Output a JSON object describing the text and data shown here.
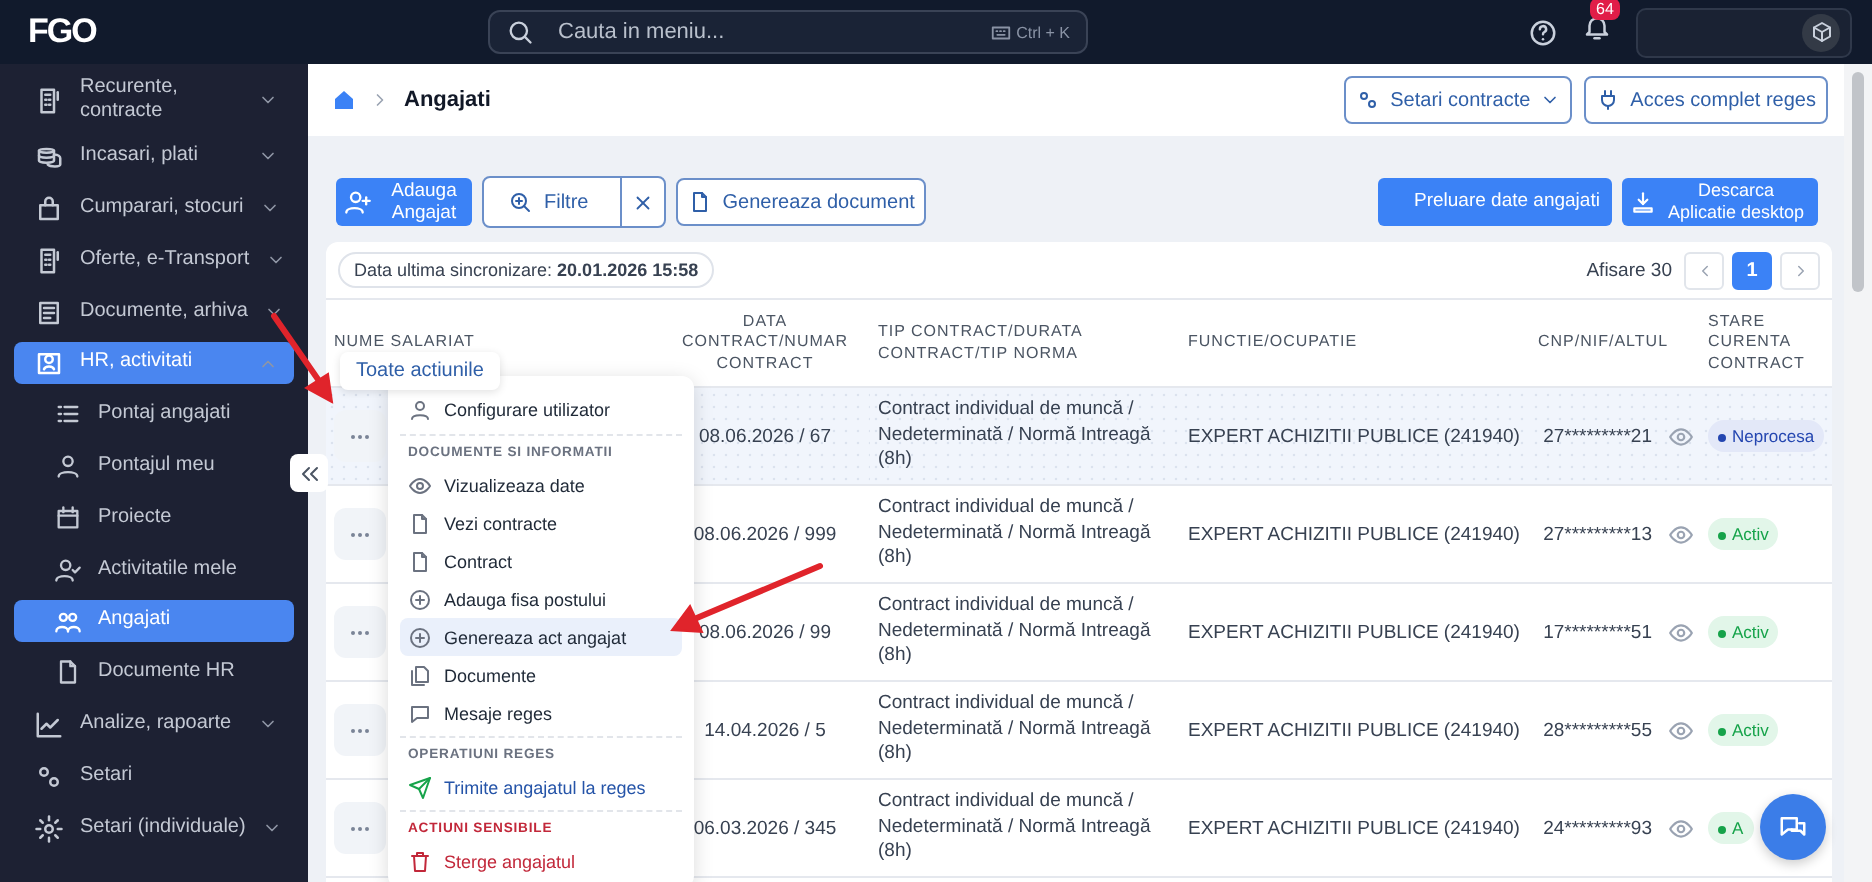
{
  "topbar": {
    "logo": "FGO",
    "search": {
      "placeholder": "Cauta in meniu...",
      "shortcut": "Ctrl + K"
    },
    "notifications": "64"
  },
  "sidebar": {
    "items": [
      {
        "label": "Recurente, contracte",
        "kind": "group",
        "expanded": false,
        "selected": false
      },
      {
        "label": "Incasari, plati",
        "kind": "group",
        "expanded": false,
        "selected": false
      },
      {
        "label": "Cumparari, stocuri",
        "kind": "group",
        "expanded": false,
        "selected": false
      },
      {
        "label": "Oferte, e-Transport",
        "kind": "group",
        "expanded": false,
        "selected": false
      },
      {
        "label": "Documente, arhiva",
        "kind": "group",
        "expanded": false,
        "selected": false
      },
      {
        "label": "HR, activitati",
        "kind": "group",
        "expanded": true,
        "selected": true,
        "children": [
          {
            "label": "Pontaj angajati",
            "selected": false
          },
          {
            "label": "Pontajul meu",
            "selected": false
          },
          {
            "label": "Proiecte",
            "selected": false
          },
          {
            "label": "Activitatile mele",
            "selected": false
          },
          {
            "label": "Angajati",
            "selected": true
          },
          {
            "label": "Documente HR",
            "selected": false
          }
        ]
      },
      {
        "label": "Analize, rapoarte",
        "kind": "group",
        "expanded": false,
        "selected": false
      },
      {
        "label": "Setari",
        "kind": "link",
        "selected": false
      },
      {
        "label": "Setari (individuale)",
        "kind": "group",
        "expanded": false,
        "selected": false
      }
    ]
  },
  "breadcrumb": {
    "current": "Angajati"
  },
  "header_buttons": [
    {
      "label": "Setari contracte",
      "kind": "dropdown"
    },
    {
      "label": "Acces complet reges",
      "kind": "plain"
    }
  ],
  "toolbar": {
    "left": [
      {
        "label": "Adauga Angajat",
        "kind": "primary"
      },
      {
        "label": "Filtre",
        "kind": "filter"
      },
      {
        "label": "Genereaza document",
        "kind": "outline"
      }
    ],
    "right": [
      {
        "label": "Preluare date angajati",
        "kind": "refresh"
      },
      {
        "label": "Descarca Aplicatie desktop",
        "kind": "download"
      }
    ]
  },
  "sync": "Data ultima sincronizare: **20.01.2026 15:58**",
  "pagination": {
    "page_size": "Afisare 30",
    "pages": [
      {
        "label": "1",
        "selected": true
      }
    ]
  },
  "table": {
    "columns": [
      "NUME SALARIAT",
      "DATA CONTRACT/NUMAR CONTRACT",
      "TIP CONTRACT/DURATA CONTRACT/TIP NORMA",
      "FUNCTIE/OCUPATIE",
      "CNP/NIF/ALTUL",
      "STARE CURENTA CONTRACT"
    ],
    "rows": [
      {
        "selected": true,
        "date": "08.06.2026 / 67",
        "contract_type": "Contract individual de muncă / Nedeterminată / Normă Intreagă (8h)",
        "function": "EXPERT ACHIZITII PUBLICE (241940)",
        "cnp": "27*********21",
        "status": {
          "label": "Neprocesa",
          "kind": "pending"
        }
      },
      {
        "selected": false,
        "date": "08.06.2026 / 999",
        "contract_type": "Contract individual de muncă / Nedeterminată / Normă Intreagă (8h)",
        "function": "EXPERT ACHIZITII PUBLICE (241940)",
        "cnp": "27*********13",
        "status": {
          "label": "Activ",
          "kind": "active"
        }
      },
      {
        "selected": false,
        "date": "08.06.2026 / 99",
        "contract_type": "Contract individual de muncă / Nedeterminată / Normă Intreagă (8h)",
        "function": "EXPERT ACHIZITII PUBLICE (241940)",
        "cnp": "17*********51",
        "status": {
          "label": "Activ",
          "kind": "active"
        }
      },
      {
        "selected": false,
        "date": "14.04.2026 / 5",
        "contract_type": "Contract individual de muncă / Nedeterminată / Normă Intreagă (8h)",
        "function": "EXPERT ACHIZITII PUBLICE (241940)",
        "cnp": "28*********55",
        "status": {
          "label": "Activ",
          "kind": "active"
        }
      },
      {
        "selected": false,
        "date": "06.03.2026 / 345",
        "contract_type": "Contract individual de muncă / Nedeterminată / Normă Intreagă (8h)",
        "function": "EXPERT ACHIZITII PUBLICE (241940)",
        "cnp": "24*********93",
        "status": {
          "label": "A",
          "kind": "active"
        }
      }
    ]
  },
  "actions_menu": {
    "tooltip": "Toate actiunile",
    "sections": [
      {
        "kind": "plain",
        "items": [
          {
            "label": "Configurare utilizator",
            "kind": "normal",
            "selected": false
          }
        ]
      },
      {
        "kind": "info",
        "heading": "DOCUMENTE SI INFORMATII",
        "items": [
          {
            "label": "Vizualizeaza date",
            "kind": "normal",
            "selected": false
          },
          {
            "label": "Vezi contracte",
            "kind": "normal",
            "selected": false
          },
          {
            "label": "Contract",
            "kind": "normal",
            "selected": false
          },
          {
            "label": "Adauga fisa postului",
            "kind": "normal",
            "selected": false
          },
          {
            "label": "Genereaza act angajat",
            "kind": "normal",
            "selected": true
          },
          {
            "label": "Documente",
            "kind": "normal",
            "selected": false
          },
          {
            "label": "Mesaje reges",
            "kind": "normal",
            "selected": false
          }
        ]
      },
      {
        "kind": "info",
        "heading": "OPERATIUNI REGES",
        "items": [
          {
            "label": "Trimite angajatul la reges",
            "kind": "reges",
            "selected": false
          }
        ]
      },
      {
        "kind": "danger",
        "heading": "ACTIUNI SENSIBILE",
        "items": [
          {
            "label": "Sterge angajatul",
            "kind": "danger",
            "selected": false
          }
        ]
      }
    ]
  }
}
